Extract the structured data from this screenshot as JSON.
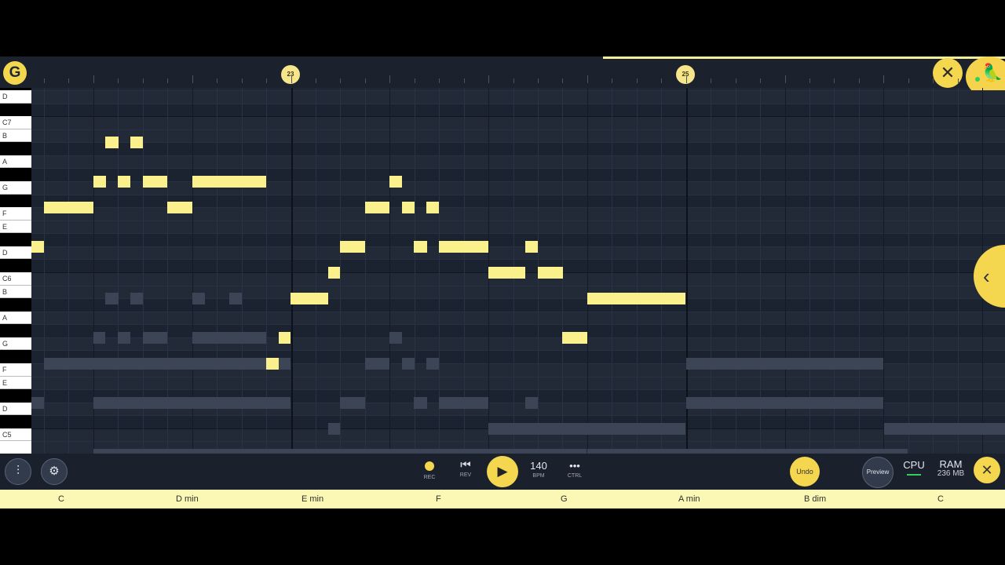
{
  "ruler": {
    "marker_23": "23",
    "marker_25": "25",
    "logo_icon": "fl-studio-mobile-logo",
    "close_icon": "close-icon",
    "fruit_icon": "fruit-mascot-icon"
  },
  "keys": {
    "labels": [
      "D",
      "C7",
      "B",
      "A",
      "G",
      "F",
      "E",
      "D",
      "C6",
      "B",
      "A",
      "G",
      "F",
      "E",
      "D",
      "C5"
    ]
  },
  "toolbar": {
    "mixer_icon": "mixer-sliders-icon",
    "keys_settings_icon": "keyboard-settings-icon",
    "rec_label": "REC",
    "rev_label": "REV",
    "play_icon": "play-icon",
    "bpm_value": "140",
    "bpm_label": "BPM",
    "ctrl_dots": "•••",
    "ctrl_label": "CTRL",
    "undo_label": "Undo",
    "preview_label": "Preview",
    "cpu_label": "CPU",
    "ram_label": "RAM",
    "ram_value": "236 MB"
  },
  "chords": [
    "C",
    "D min",
    "E min",
    "F",
    "G",
    "A min",
    "B dim",
    "C"
  ],
  "colors": {
    "note": "#fbf18c",
    "accent": "#f4d64f",
    "background": "#1f2735"
  }
}
